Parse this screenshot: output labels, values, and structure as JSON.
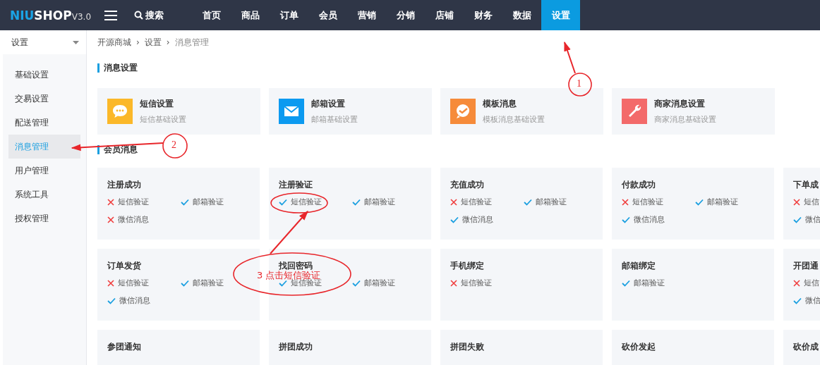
{
  "header": {
    "logo": {
      "accent": "NIU",
      "name": "SHOP",
      "version": "V3.0"
    },
    "search": "搜索",
    "nav": [
      {
        "label": "首页",
        "selected": false
      },
      {
        "label": "商品",
        "selected": false
      },
      {
        "label": "订单",
        "selected": false
      },
      {
        "label": "会员",
        "selected": false
      },
      {
        "label": "营销",
        "selected": false
      },
      {
        "label": "分销",
        "selected": false
      },
      {
        "label": "店铺",
        "selected": false
      },
      {
        "label": "财务",
        "selected": false
      },
      {
        "label": "数据",
        "selected": false
      },
      {
        "label": "设置",
        "selected": true
      }
    ]
  },
  "sidebar": {
    "select": "设置",
    "items": [
      {
        "label": "基础设置",
        "selected": false
      },
      {
        "label": "交易设置",
        "selected": false
      },
      {
        "label": "配送管理",
        "selected": false
      },
      {
        "label": "消息管理",
        "selected": true
      },
      {
        "label": "用户管理",
        "selected": false
      },
      {
        "label": "系统工具",
        "selected": false
      },
      {
        "label": "授权管理",
        "selected": false
      }
    ]
  },
  "breadcrumb": {
    "separator": "›",
    "items": [
      "开源商城",
      "设置",
      "消息管理"
    ]
  },
  "message_settings": {
    "title": "消息设置",
    "cards": [
      {
        "kind": "chat",
        "title": "短信设置",
        "subtitle": "短信基础设置"
      },
      {
        "kind": "mail",
        "title": "邮箱设置",
        "subtitle": "邮箱基础设置"
      },
      {
        "kind": "template",
        "title": "模板消息",
        "subtitle": "模板消息基础设置"
      },
      {
        "kind": "wrench",
        "title": "商家消息设置",
        "subtitle": "商家消息基础设置"
      }
    ]
  },
  "member_messages": {
    "title": "会员消息",
    "cards": [
      {
        "title": "注册成功",
        "items": [
          {
            "label": "短信验证",
            "enabled": false
          },
          {
            "label": "邮箱验证",
            "enabled": true
          },
          {
            "label": "微信消息",
            "enabled": false
          }
        ]
      },
      {
        "title": "注册验证",
        "items": [
          {
            "label": "短信验证",
            "enabled": true
          },
          {
            "label": "邮箱验证",
            "enabled": true
          }
        ]
      },
      {
        "title": "充值成功",
        "items": [
          {
            "label": "短信验证",
            "enabled": false
          },
          {
            "label": "邮箱验证",
            "enabled": true
          },
          {
            "label": "微信消息",
            "enabled": true
          }
        ]
      },
      {
        "title": "付款成功",
        "items": [
          {
            "label": "短信验证",
            "enabled": false
          },
          {
            "label": "邮箱验证",
            "enabled": true
          },
          {
            "label": "微信消息",
            "enabled": true
          }
        ]
      },
      {
        "title": "下单成",
        "items": [
          {
            "label": "短信",
            "enabled": false
          },
          {
            "label": "微信",
            "enabled": true
          }
        ]
      },
      {
        "title": "订单发货",
        "items": [
          {
            "label": "短信验证",
            "enabled": false
          },
          {
            "label": "邮箱验证",
            "enabled": true
          },
          {
            "label": "微信消息",
            "enabled": true
          }
        ]
      },
      {
        "title": "找回密码",
        "items": [
          {
            "label": "短信验证",
            "enabled": true
          },
          {
            "label": "邮箱验证",
            "enabled": true
          }
        ]
      },
      {
        "title": "手机绑定",
        "items": [
          {
            "label": "短信验证",
            "enabled": false
          }
        ]
      },
      {
        "title": "邮箱绑定",
        "items": [
          {
            "label": "邮箱验证",
            "enabled": true
          }
        ]
      },
      {
        "title": "开团通",
        "items": [
          {
            "label": "短信",
            "enabled": false
          },
          {
            "label": "微信",
            "enabled": true
          }
        ]
      },
      {
        "title": "参团通知"
      },
      {
        "title": "拼团成功"
      },
      {
        "title": "拼团失败"
      },
      {
        "title": "砍价发起"
      },
      {
        "title": "砍价成"
      }
    ]
  },
  "annotations": [
    "1",
    "2",
    "3 点击短信验证"
  ]
}
